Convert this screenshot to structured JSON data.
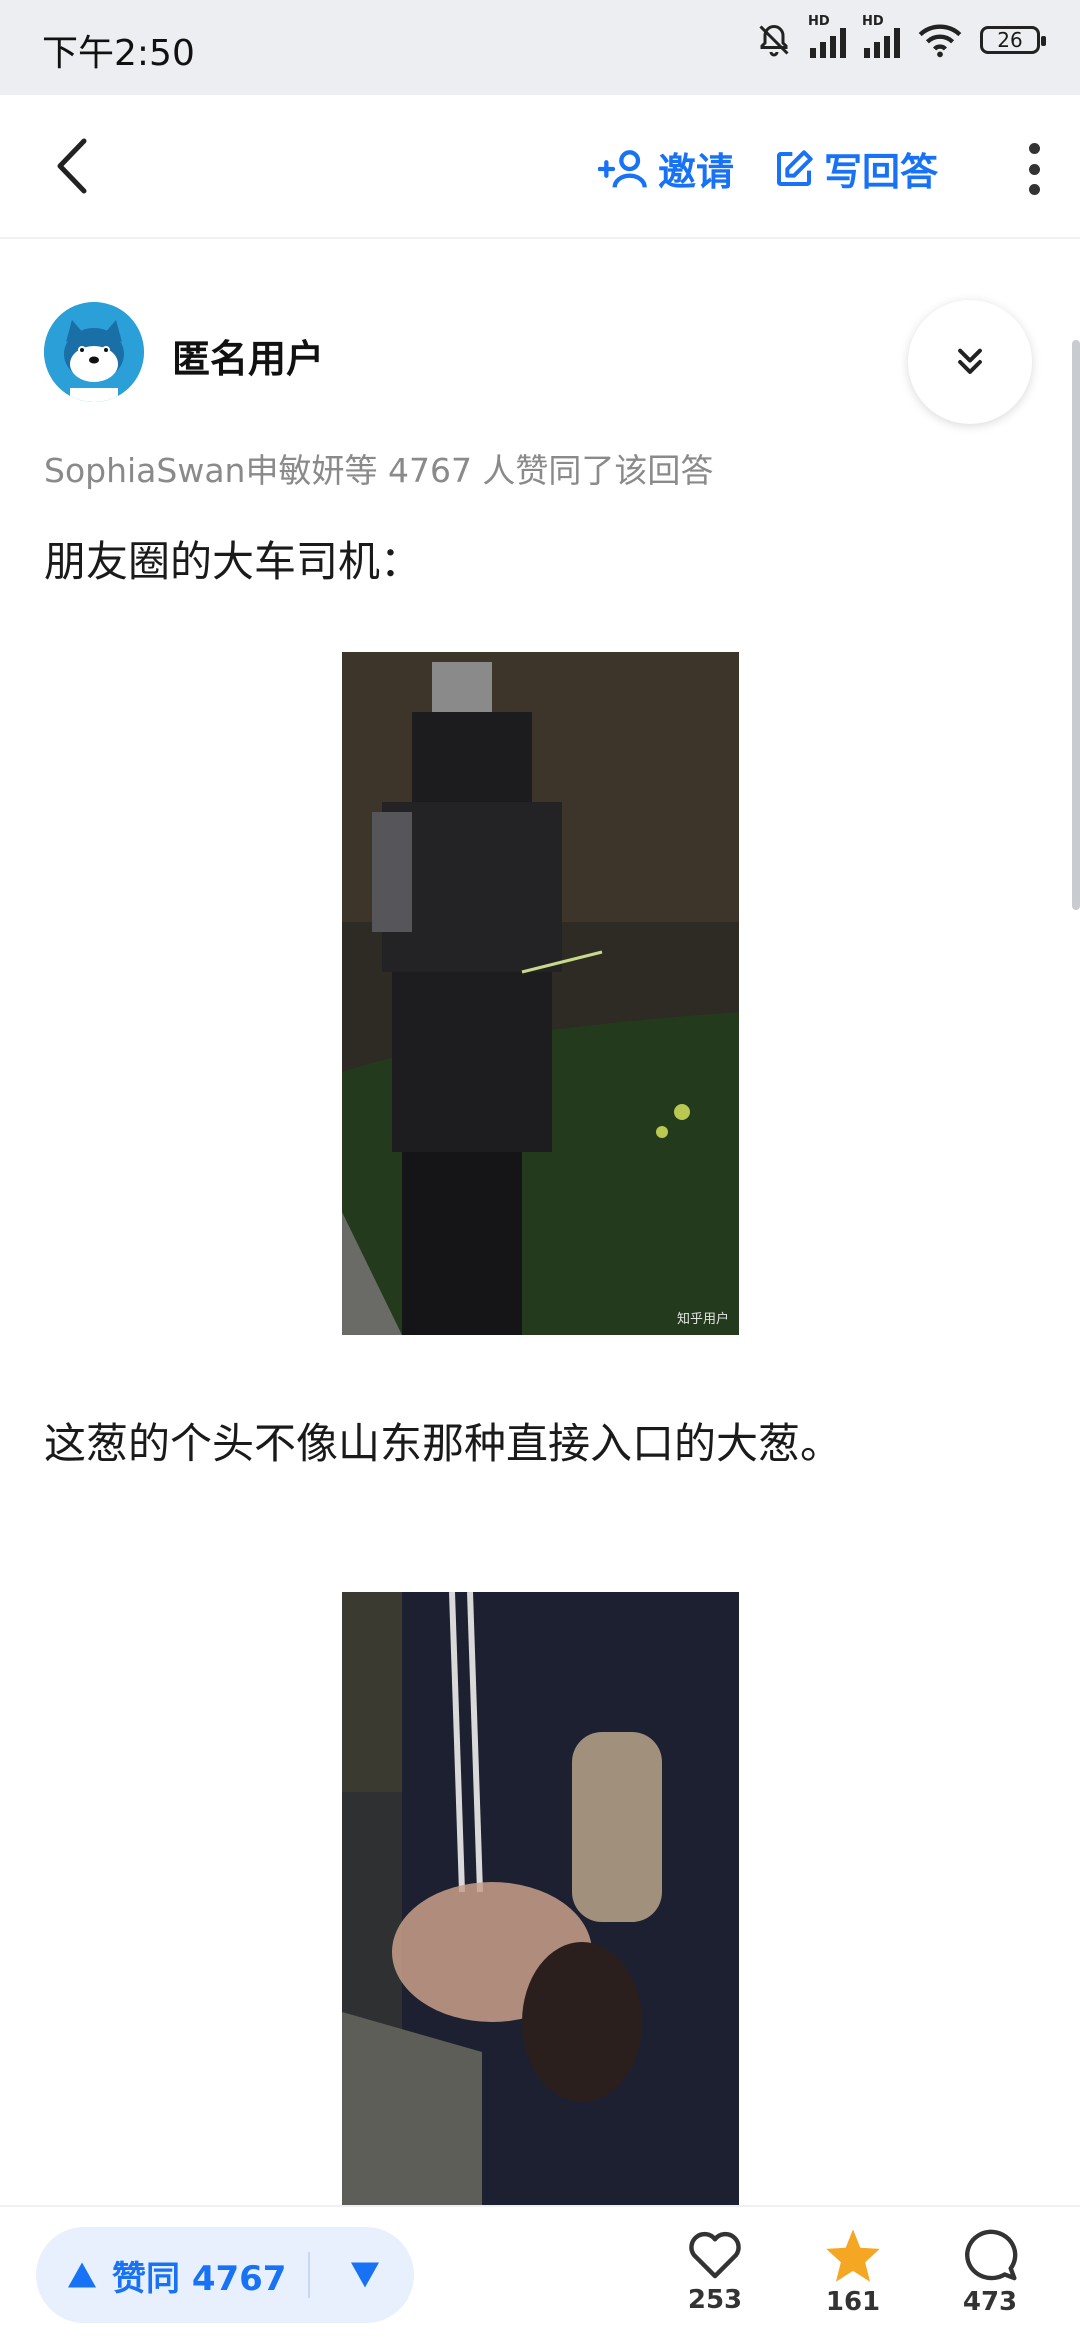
{
  "status_bar": {
    "time": "下午2:50",
    "battery": "26",
    "signal_label": "HD"
  },
  "nav": {
    "invite_label": "邀请",
    "write_label": "写回答"
  },
  "author": {
    "name": "匿名用户"
  },
  "answer": {
    "likes_line": "SophiaSwan申敏妍等 4767 人赞同了该回答",
    "paragraph1": "朋友圈的大车司机：",
    "paragraph2": "这葱的个头不像山东那种直接入口的大葱。",
    "image_watermark": "知乎用户"
  },
  "bottom_bar": {
    "vote_up_label": "赞同 4767",
    "like_count": "253",
    "favorite_count": "161",
    "comment_count": "473"
  },
  "colors": {
    "accent": "#1772f6",
    "favorite": "#f5a623"
  }
}
